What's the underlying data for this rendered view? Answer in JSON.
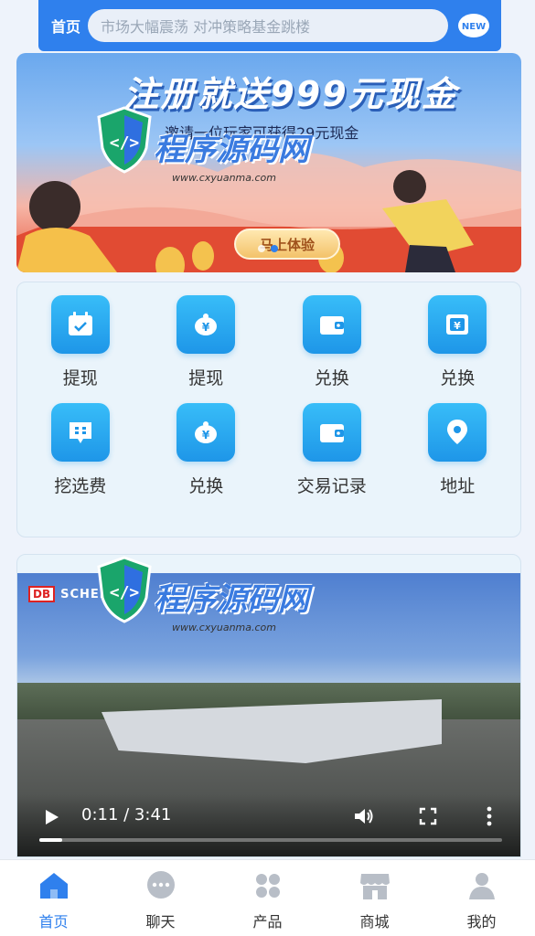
{
  "header": {
    "home_label": "首页",
    "ticker_text": "市场大幅震荡 对冲策略基金跳楼",
    "new_badge": "NEW"
  },
  "banner": {
    "headline": "注册就送999元现金",
    "subtitle": "邀请一位玩家可获得29元现金",
    "cta_label": "马上体验",
    "slide_index": 1,
    "slide_count": 2
  },
  "watermark": {
    "text": "程序源码网",
    "url": "www.cxyuanma.com"
  },
  "grid": {
    "items": [
      {
        "label": "提现",
        "icon": "calendar-check-icon"
      },
      {
        "label": "提现",
        "icon": "piggy-bank-icon"
      },
      {
        "label": "兑换",
        "icon": "wallet-icon"
      },
      {
        "label": "兑换",
        "icon": "yen-safe-icon"
      },
      {
        "label": "挖选费",
        "icon": "chat-grid-icon"
      },
      {
        "label": "兑换",
        "icon": "piggy-bank-icon"
      },
      {
        "label": "交易记录",
        "icon": "wallet-icon"
      },
      {
        "label": "地址",
        "icon": "location-pin-icon"
      }
    ]
  },
  "video": {
    "brand_logo": "DB",
    "brand_name": "SCHENKER",
    "time_display": "0:11 / 3:41",
    "progress_fraction": 0.05
  },
  "bottom_nav": {
    "items": [
      {
        "label": "首页",
        "icon": "home-icon",
        "active": true
      },
      {
        "label": "聊天",
        "icon": "chat-icon",
        "active": false
      },
      {
        "label": "产品",
        "icon": "apps-icon",
        "active": false
      },
      {
        "label": "商城",
        "icon": "store-icon",
        "active": false
      },
      {
        "label": "我的",
        "icon": "user-icon",
        "active": false
      }
    ]
  },
  "colors": {
    "accent": "#2f80ed",
    "tile": "#1e96e8",
    "nav_inactive": "#b8bec7"
  }
}
